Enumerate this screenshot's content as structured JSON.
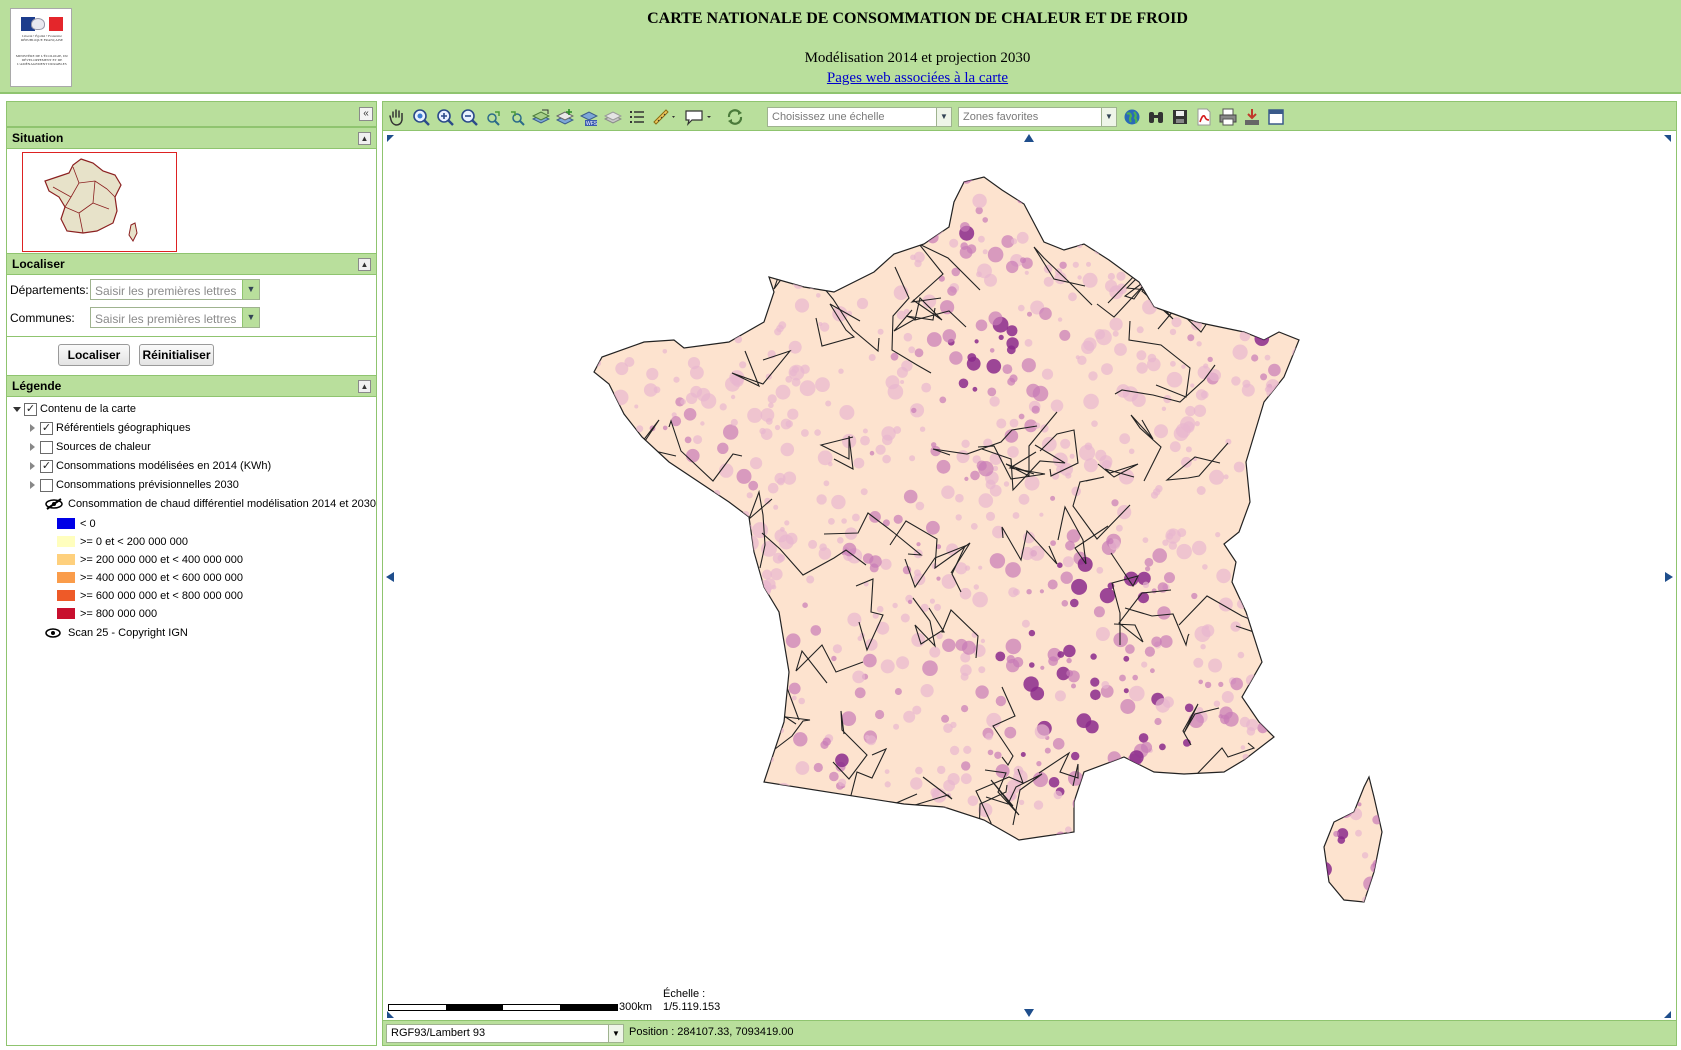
{
  "header": {
    "title": "CARTE NATIONALE DE CONSOMMATION DE CHALEUR ET DE FROID",
    "subtitle": "Modélisation 2014 et projection 2030",
    "link": "Pages web associées à la carte",
    "logo_text": "Liberté • Égalité • Fraternité RÉPUBLIQUE FRANÇAISE",
    "logo_ministry": "MINISTÈRE DE L'ÉCOLOGIE, DU DÉVELOPPEMENT ET DE L'AMÉNAGEMENT DURABLES"
  },
  "sidebar": {
    "collapse_label": "«",
    "situation": {
      "title": "Situation"
    },
    "localiser": {
      "title": "Localiser",
      "departements_label": "Départements:",
      "departements_placeholder": "Saisir les premières lettres",
      "communes_label": "Communes:",
      "communes_placeholder": "Saisir les premières lettres",
      "localiser_button": "Localiser",
      "reset_button": "Réinitialiser"
    },
    "legende": {
      "title": "Légende",
      "root": "Contenu de la carte",
      "nodes": [
        {
          "label": "Référentiels géographiques",
          "checked": true
        },
        {
          "label": "Sources de chaleur",
          "checked": false
        },
        {
          "label": "Consommations modélisées en 2014 (KWh)",
          "checked": true
        },
        {
          "label": "Consommations prévisionnelles 2030",
          "checked": false
        }
      ],
      "layer_title": "Consommation de chaud différentiel modélisation 2014 et 2030",
      "classes": [
        {
          "label": "< 0",
          "color": "#0000e6"
        },
        {
          "label": ">= 0 et < 200 000 000",
          "color": "#fffebe"
        },
        {
          "label": ">= 200 000 000 et < 400 000 000",
          "color": "#fed07d"
        },
        {
          "label": ">= 400 000 000 et < 600 000 000",
          "color": "#fa9c4a"
        },
        {
          "label": ">= 600 000 000 et < 800 000 000",
          "color": "#ee5a28"
        },
        {
          "label": ">= 800 000 000",
          "color": "#c8102e"
        }
      ],
      "scan_label": "Scan 25 - Copyright IGN"
    }
  },
  "toolbar": {
    "tools": [
      "pan-icon",
      "zoom-extent-icon",
      "zoom-in-icon",
      "zoom-out-icon",
      "previous-view-icon",
      "next-view-icon",
      "layers-icon",
      "layers-add-icon",
      "wfs-icon",
      "layers-hide-icon",
      "list-icon",
      "measure-icon",
      "comment-icon",
      "refresh-icon"
    ],
    "scale_placeholder": "Choisissez une échelle",
    "zones_placeholder": "Zones favorites",
    "right_tools": [
      "globe-icon",
      "binoculars-icon",
      "save-icon",
      "pdf-icon",
      "print-icon",
      "download-icon",
      "window-icon"
    ]
  },
  "map": {
    "scale_label": "300km",
    "echelle_label": "Échelle :",
    "echelle_value": "1/5.119.153"
  },
  "statusbar": {
    "projection": "RGF93/Lambert 93",
    "position": "Position : 284107.33, 7093419.00"
  },
  "colors": {
    "header_bg": "#b9df9c",
    "border": "#8fc46f",
    "map_base": "#fde3cf",
    "map_light": "#e8b7cf",
    "map_mid": "#c77ab6",
    "map_dark": "#8b2a8c"
  }
}
